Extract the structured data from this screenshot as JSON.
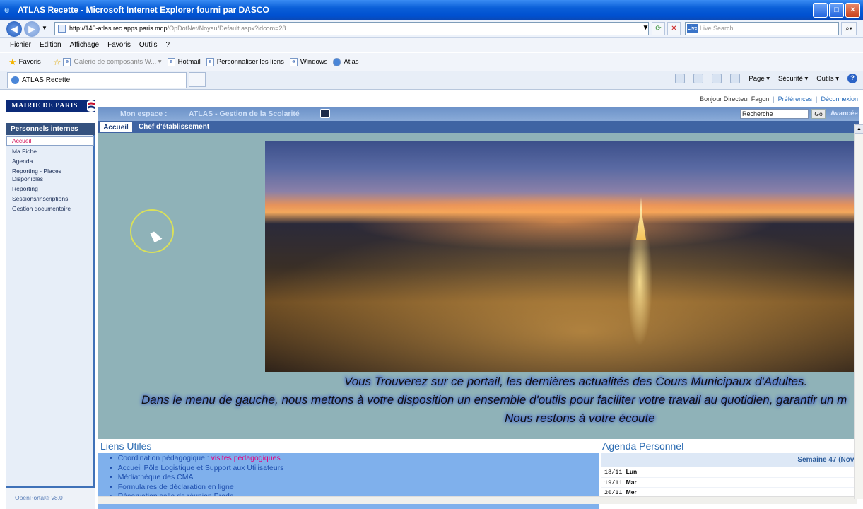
{
  "window": {
    "title": "ATLAS Recette - Microsoft Internet Explorer fourni par DASCO",
    "buttons": [
      "_",
      "□",
      "×"
    ]
  },
  "address": {
    "url_host": "http://140-atlas.rec.apps.paris.mdp",
    "url_path": "/OpDotNet/Noyau/Default.aspx?idcom=28",
    "search_placeholder": "Live Search",
    "search_brand": "Live"
  },
  "menu": [
    "Fichier",
    "Edition",
    "Affichage",
    "Favoris",
    "Outils",
    "?"
  ],
  "favorites": {
    "label": "Favoris",
    "items": [
      {
        "label": "Galerie de composants W...",
        "dim": true
      },
      {
        "label": "Hotmail"
      },
      {
        "label": "Personnaliser les liens"
      },
      {
        "label": "Windows"
      },
      {
        "label": "Atlas"
      }
    ]
  },
  "tab": {
    "label": "ATLAS Recette"
  },
  "commandbar": [
    "Page ▾",
    "Sécurité ▾",
    "Outils ▾",
    "?"
  ],
  "portal": {
    "logo": "MAIRIE DE PARIS",
    "greeting": "Bonjour Directeur Fagon",
    "preferences": "Préférences",
    "logout": "Déconnexion",
    "mon_espace": "Mon espace :",
    "app_title": "ATLAS - Gestion de la Scolarité",
    "search_value": "Recherche",
    "go": "Go",
    "advanced": "Avancée",
    "tabs": [
      "Accueil",
      "Chef d'établissement"
    ],
    "side_header": "Personnels internes",
    "side_items": [
      {
        "label": "Accueil",
        "active": true
      },
      {
        "label": "Ma Fiche"
      },
      {
        "label": "Agenda"
      },
      {
        "label": "Reporting - Places Disponibles"
      },
      {
        "label": "Reporting"
      },
      {
        "label": "Sessions/inscriptions"
      },
      {
        "label": "Gestion documentaire"
      }
    ],
    "footer": "OpenPortal® v8.0",
    "messages": [
      "Vous Trouverez sur ce portail, les dernières actualités des Cours Municipaux d'Adultes.",
      "Dans le menu de gauche, nous mettons à votre disposition un ensemble d'outils pour faciliter votre travail au quotidien, garantir un m",
      "Nous restons à votre écoute"
    ],
    "liens_title": "Liens Utiles",
    "liens": {
      "coord": "Coordination pédagogique : ",
      "coord_pink": "visites pédagogiques",
      "l2": "Accueil Pôle Logistique et Support aux Utilisateurs",
      "l3": "Médiathèque des CMA",
      "l4": "Formulaires  de déclaration en ligne",
      "l5": "Réservation  salle de réunion Proda"
    },
    "agenda_title": "Agenda Personnel",
    "agenda_week": "Semaine 47 (Nove",
    "agenda_rows": [
      {
        "date": "18/11",
        "day": "Lun"
      },
      {
        "date": "19/11",
        "day": "Mar"
      },
      {
        "date": "20/11",
        "day": "Mer"
      }
    ]
  }
}
